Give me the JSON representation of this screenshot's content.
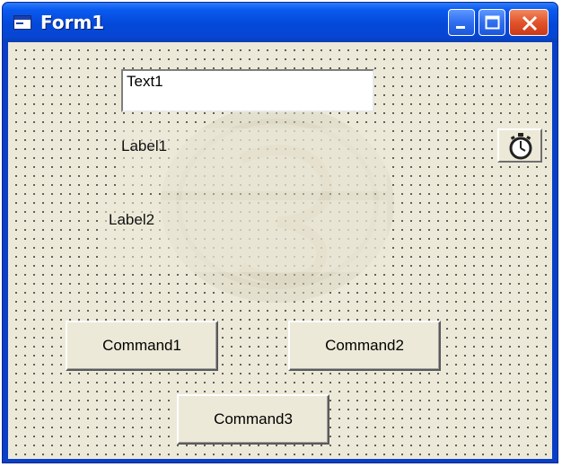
{
  "window": {
    "title": "Form1"
  },
  "title_buttons": {
    "minimize_icon": "minimize-icon",
    "maximize_icon": "maximize-icon",
    "close_icon": "close-icon"
  },
  "controls": {
    "text1": {
      "value": "Text1"
    },
    "label1": "Label1",
    "label2": "Label2",
    "timer_icon": "stopwatch-icon",
    "command1": "Command1",
    "command2": "Command2",
    "command3": "Command3"
  },
  "colors": {
    "titlebar": "#0a5af0",
    "client": "#ece9d8",
    "close_button": "#e2532a"
  }
}
